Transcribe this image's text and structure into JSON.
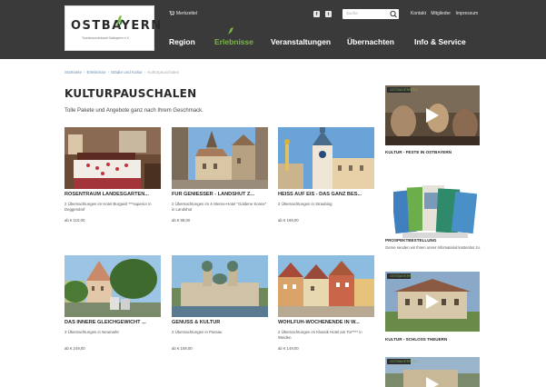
{
  "header": {
    "logo_text": "OSTBAYERN",
    "logo_sub": "Tourismusverband Ostbayern e.V.",
    "merkzettel": "Merkzettel",
    "search_placeholder": "Suche",
    "top_links": [
      "Kontakt",
      "Mitglieder",
      "Impressum"
    ],
    "nav": [
      {
        "label": "Region",
        "active": false
      },
      {
        "label": "Erlebnisse",
        "active": true
      },
      {
        "label": "Veranstaltungen",
        "active": false
      },
      {
        "label": "Übernachten",
        "active": false
      },
      {
        "label": "Info & Service",
        "active": false
      }
    ],
    "colors": {
      "bar": "#3a3a3a",
      "accent": "#7ab648"
    }
  },
  "breadcrumb": [
    "Startseite",
    "Erlebnisse",
    "Städte und Kultur",
    "Kulturpauschalen"
  ],
  "main": {
    "title": "KULTURPAUSCHALEN",
    "subtitle": "Tolle Pakete und Angebote ganz nach Ihrem Geschmack.",
    "cards": [
      {
        "title": "ROSENTRAUM LANDESGARTEN...",
        "desc": "2 Übernachtungen im Hotel Burgwirt ***superior in Deggendorf",
        "price": "ab € 110,00",
        "image": "hotel-room"
      },
      {
        "title": "FÜR GENIESSER - LANDSHUT Z...",
        "desc": "2 Übernachtungen im 4-Sterne-Hotel \"Goldene Sonne\" in Landshut",
        "price": "ab € 98,00",
        "image": "landshut-old-town"
      },
      {
        "title": "HEISS AUF EIS - DAS GANZ BES...",
        "desc": "2 Übernachtungen in Straubing",
        "price": "ab € 169,00",
        "image": "straubing-tower"
      },
      {
        "title": "DAS INNERE GLEICHGEWICHT ...",
        "desc": "3 Übernachtungen in Neumarkt",
        "price": "ab € 249,00",
        "image": "town-square"
      },
      {
        "title": "GENUSS & KULTUR",
        "desc": "2 Übernachtungen in Passau",
        "price": "ab € 159,00",
        "image": "passau-cathedral"
      },
      {
        "title": "WOHLFÜH-WOCHENENDE IN W...",
        "desc": "2 Übernachtungen im Klassik Hotel am Tor**** in Weiden",
        "price": "ab € 149,00",
        "image": "weiden-market"
      }
    ]
  },
  "sidebar": {
    "video_badge": "OSTBAYERN TV",
    "video1_caption": "KULTUR - FESTE IN OSTBAYERN",
    "brochure_caption": "PROSPEKTBESTELLUNG",
    "brochure_text": "Gerne senden wir Ihnen unser Infomaterial kostenlos zu.",
    "video2_caption": "KULTUR - SCHLOSS THEUERN"
  }
}
